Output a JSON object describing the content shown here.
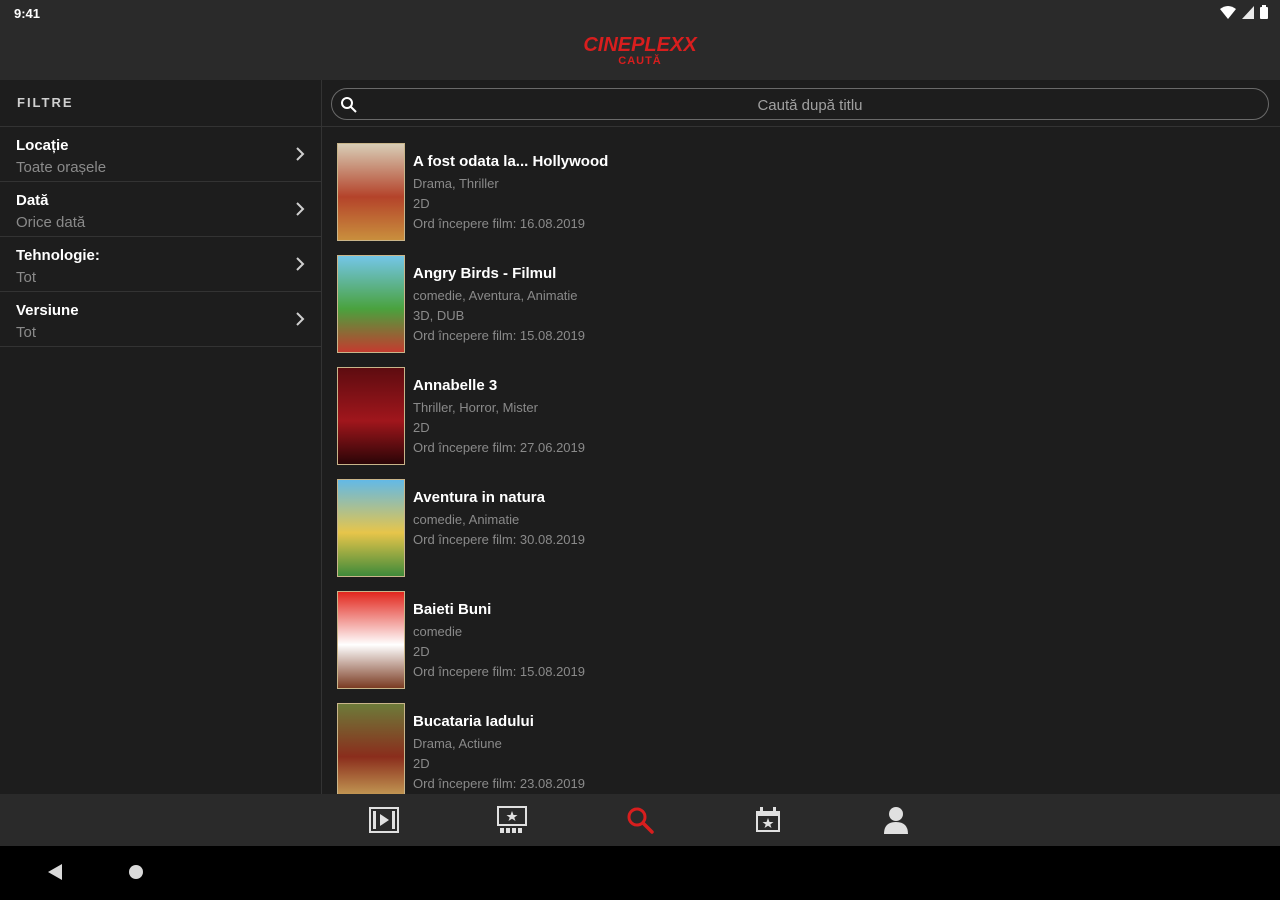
{
  "status_bar": {
    "time": "9:41"
  },
  "header": {
    "brand": "CINEPLEXX",
    "section": "CAUTĂ"
  },
  "sidebar": {
    "title": "FILTRE",
    "filters": [
      {
        "label": "Locație",
        "value": "Toate orașele"
      },
      {
        "label": "Dată",
        "value": "Orice dată"
      },
      {
        "label": "Tehnologie:",
        "value": "Tot"
      },
      {
        "label": "Versiune",
        "value": "Tot"
      }
    ]
  },
  "search": {
    "placeholder": "Caută după titlu",
    "value": ""
  },
  "movies": [
    {
      "title": "A fost odata la... Hollywood",
      "genres": "Drama, Thriller",
      "format": "2D",
      "start": "Ord începere film: 16.08.2019",
      "poster_colors": [
        "#d8cdb6",
        "#b4432a",
        "#c98f3d"
      ]
    },
    {
      "title": "Angry Birds - Filmul",
      "genres": "comedie, Aventura, Animatie",
      "format": "3D, DUB",
      "start": "Ord începere film: 15.08.2019",
      "poster_colors": [
        "#74c6e8",
        "#4aa23e",
        "#c43b2f"
      ]
    },
    {
      "title": "Annabelle 3",
      "genres": "Thriller, Horror, Mister",
      "format": "2D",
      "start": "Ord începere film: 27.06.2019",
      "poster_colors": [
        "#5e0c10",
        "#a0161c",
        "#2b0507"
      ]
    },
    {
      "title": "Aventura in natura",
      "genres": "comedie, Animatie",
      "format": "",
      "start": "Ord începere film: 30.08.2019",
      "poster_colors": [
        "#63b9e6",
        "#e7c54a",
        "#3f8a3a"
      ]
    },
    {
      "title": "Baieti Buni",
      "genres": "comedie",
      "format": "2D",
      "start": "Ord începere film: 15.08.2019",
      "poster_colors": [
        "#e2271d",
        "#ffffff",
        "#7a3b22"
      ]
    },
    {
      "title": "Bucataria Iadului",
      "genres": "Drama, Actiune",
      "format": "2D",
      "start": "Ord începere film: 23.08.2019",
      "poster_colors": [
        "#6d7b3a",
        "#8a2d1c",
        "#c9a55a"
      ]
    }
  ],
  "bottom_nav": {
    "items": [
      {
        "icon": "play-icon",
        "active": false
      },
      {
        "icon": "cinema-icon",
        "active": false
      },
      {
        "icon": "search-icon",
        "active": true
      },
      {
        "icon": "calendar-star-icon",
        "active": false
      },
      {
        "icon": "profile-icon",
        "active": false
      }
    ],
    "active_color": "#d81e1e",
    "inactive_color": "#e0e0e0"
  },
  "colors": {
    "accent": "#d81e1e",
    "background": "#1d1d1d",
    "bar": "#2a2a2a"
  }
}
